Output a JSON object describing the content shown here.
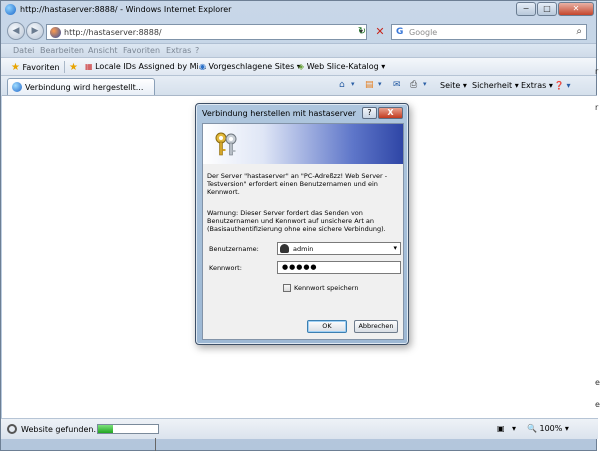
{
  "window": {
    "title": "http://hastaserver:8888/ - Windows Internet Explorer",
    "buttons": [
      "−",
      "□",
      "✕"
    ]
  },
  "address": {
    "url": "http://hastaserver:8888/",
    "dropdown": "▾",
    "refresh": "↻",
    "stop": "✕"
  },
  "search": {
    "logo": "G",
    "placeholder": "Google",
    "button": "⌕"
  },
  "nav": {
    "back": "◀",
    "forward": "▶"
  },
  "menu": [
    "Datei",
    "Bearbeiten",
    "Ansicht",
    "Favoriten",
    "Extras",
    "?"
  ],
  "favorites": {
    "label": "Favoriten",
    "items": [
      "Locale IDs Assigned by Mi...",
      "Vorgeschlagene Sites ▾",
      "Web Slice-Katalog ▾"
    ]
  },
  "tab": {
    "label": "Verbindung wird hergestellt..."
  },
  "toolbar": {
    "icons": [
      "⌂",
      "▾",
      "▤",
      "▾",
      "✉",
      "⎙",
      "▾"
    ],
    "seite": "Seite ▾",
    "sicherheit": "Sicherheit ▾",
    "extras": "Extras ▾",
    "help": "❓ ▾"
  },
  "status": {
    "text": "Website gefunden. W...",
    "progress": 0.25,
    "icons": [
      "▣",
      "▾"
    ],
    "zoom": "🔍 100%  ▾"
  },
  "dialog": {
    "title": "Verbindung herstellen mit hastaserver",
    "help": "?",
    "close": "X",
    "text1": "Der Server \"hastaserver\" an \"PC-Adreßzz! Web Server - Testversion\" erfordert einen Benutzernamen und ein Kennwort.",
    "text2": "Warnung: Dieser Server fordert das Senden von Benutzernamen und Kennwort auf unsichere Art an (Basisauthentifizierung ohne eine sichere Verbindung).",
    "username_label": "Benutzername:",
    "username_value": "admin",
    "password_label": "Kennwort:",
    "password_value": "●●●●●",
    "remember_label": "Kennwort speichern",
    "ok_label": "OK",
    "cancel_label": "Abbrechen"
  },
  "page_edge": [
    "r",
    "r",
    "e",
    "e"
  ]
}
